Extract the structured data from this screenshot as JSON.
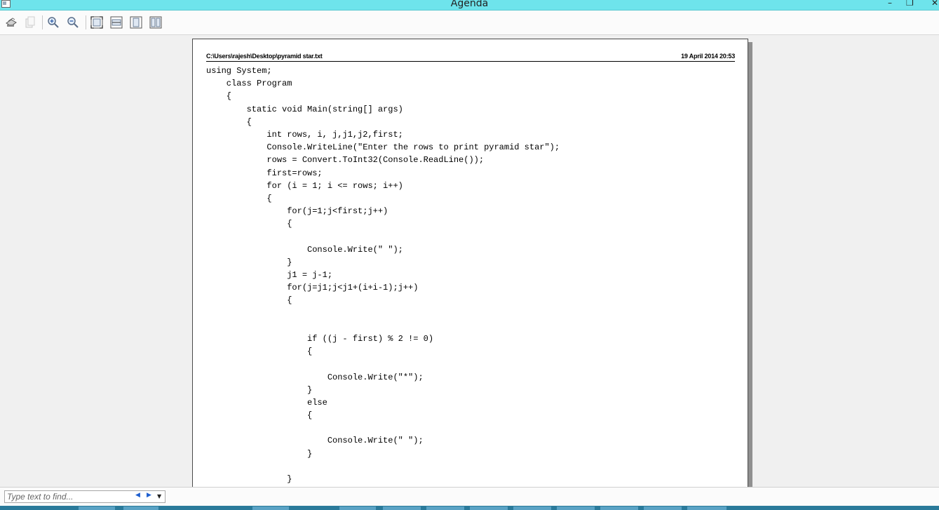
{
  "window": {
    "title": "Agenda",
    "minimize_glyph": "–",
    "maximize_glyph": "❐",
    "close_glyph": "✕"
  },
  "toolbar": {
    "buttons": [
      "print-icon",
      "copy-icon",
      "zoom-in-icon",
      "zoom-out-icon",
      "fit-page-icon",
      "fit-width-icon",
      "single-page-icon",
      "two-pages-icon"
    ]
  },
  "document": {
    "path": "C:\\Users\\rajesh\\Desktop\\pyramid star.txt",
    "date": "19 April 2014 20:53",
    "lines": [
      "using System;",
      "    class Program",
      "    {",
      "        static void Main(string[] args)",
      "        {",
      "            int rows, i, j,j1,j2,first;",
      "            Console.WriteLine(\"Enter the rows to print pyramid star\");",
      "            rows = Convert.ToInt32(Console.ReadLine());",
      "            first=rows;",
      "            for (i = 1; i <= rows; i++)",
      "            {",
      "                for(j=1;j<first;j++)",
      "                {",
      "",
      "                    Console.Write(\" \");",
      "                }",
      "                j1 = j-1;",
      "                for(j=j1;j<j1+(i+i-1);j++)",
      "                {",
      "",
      "",
      "                    if ((j - first) % 2 != 0)",
      "                    {",
      "",
      "                        Console.Write(\"*\");",
      "                    }",
      "                    else",
      "                    {",
      "",
      "                        Console.Write(\" \");",
      "                    }",
      "",
      "                }"
    ]
  },
  "findbar": {
    "placeholder": "Type text to find...",
    "prev_glyph": "◀",
    "next_glyph": "▶",
    "options_glyph": "▼"
  },
  "colors": {
    "titlebar": "#6ee4ec",
    "taskbar": "#2a7a9a"
  }
}
